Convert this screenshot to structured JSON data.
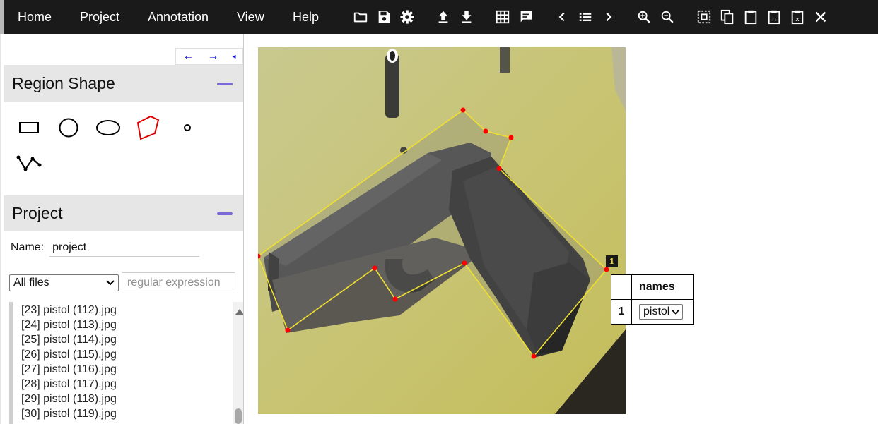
{
  "menu": {
    "items": [
      {
        "label": "Home"
      },
      {
        "label": "Project"
      },
      {
        "label": "Annotation"
      },
      {
        "label": "View"
      },
      {
        "label": "Help"
      }
    ]
  },
  "toolbar": {
    "icons": [
      "folder-open-icon",
      "save-icon",
      "settings-gear-icon",
      "upload-icon",
      "download-icon",
      "grid-icon",
      "comment-icon",
      "previous-icon",
      "list-icon",
      "next-icon",
      "zoom-in-icon",
      "zoom-out-icon",
      "select-all-icon",
      "copy-icon",
      "paste-icon",
      "paste-n-icon",
      "delete-selected-icon",
      "close-icon"
    ]
  },
  "sidebar": {
    "nav_arrows": {
      "left": "←",
      "right": "→",
      "collapse": "◂"
    },
    "region_shape": {
      "title": "Region Shape",
      "shapes": [
        "rectangle",
        "circle",
        "ellipse",
        "polygon",
        "point",
        "polyline"
      ],
      "active_shape": "polygon",
      "active_color": "#e00000"
    },
    "project": {
      "title": "Project",
      "name_label": "Name:",
      "name_value": "project",
      "filter_selected": "All files",
      "regex_placeholder": "regular expression",
      "files": [
        "[23] pistol (112).jpg",
        "[24] pistol (113).jpg",
        "[25] pistol (114).jpg",
        "[26] pistol (115).jpg",
        "[27] pistol (116).jpg",
        "[28] pistol (117).jpg",
        "[29] pistol (118).jpg",
        "[30] pistol (119).jpg"
      ]
    }
  },
  "annotation": {
    "region_id": "1",
    "polygon_color": "#f0e030",
    "vertex_color": "#ff0000",
    "attribute_table": {
      "header": "names",
      "rows": [
        {
          "id": "1",
          "value": "pistol"
        }
      ]
    }
  },
  "colors": {
    "topbar": "#1a1a1a",
    "panel_header": "#e6e6e6",
    "accent_minus": "#7a6ad8"
  }
}
